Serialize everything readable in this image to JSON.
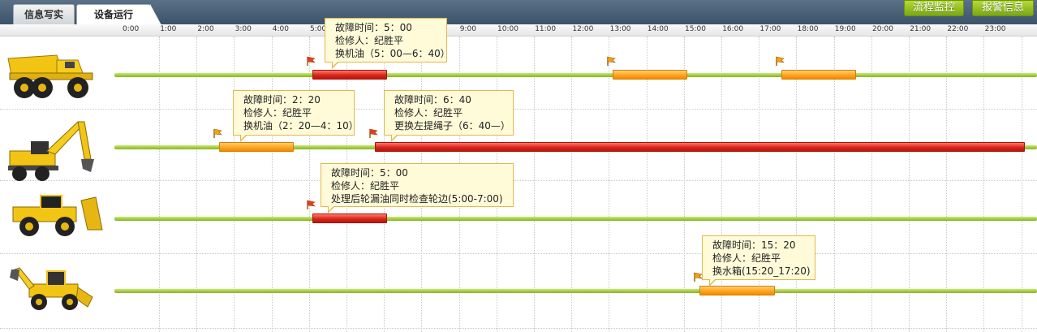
{
  "tabs": [
    {
      "label": "信息写实",
      "active": false
    },
    {
      "label": "设备运行",
      "active": true
    }
  ],
  "buttons": {
    "process": "流程监控",
    "alarm": "报警信息"
  },
  "hours": [
    "0:00",
    "1:00",
    "2:00",
    "3:00",
    "4:00",
    "5:00",
    "6:00",
    "7:00",
    "8:00",
    "9:00",
    "10:00",
    "11:00",
    "12:00",
    "13:00",
    "14:00",
    "15:00",
    "16:00",
    "17:00",
    "18:00",
    "19:00",
    "20:00",
    "21:00",
    "22:00",
    "23:00"
  ],
  "machines": [
    {
      "name": "dump-truck",
      "faults": [
        {
          "color": "red",
          "start": 5.0,
          "end": 7.0
        },
        {
          "color": "orange",
          "start": 13.0,
          "end": 15.0
        },
        {
          "color": "orange",
          "start": 17.5,
          "end": 19.5
        }
      ],
      "tooltip": {
        "time": "故障时间：5：00",
        "repairer": "检修人：纪胜平",
        "task": "换机油（5：00—6：40）"
      }
    },
    {
      "name": "wheel-excavator",
      "faults": [
        {
          "color": "orange",
          "start": 2.5,
          "end": 4.5
        },
        {
          "color": "red",
          "start": 6.67,
          "end": 24
        }
      ],
      "tooltips": [
        {
          "time": "故障时间：2：20",
          "repairer": "检修人：纪胜平",
          "task": "换机油（2：20—4：10）"
        },
        {
          "time": "故障时间：6：40",
          "repairer": "检修人：纪胜平",
          "task": "更换左提绳子（6：40—）"
        }
      ]
    },
    {
      "name": "wheel-dozer",
      "faults": [
        {
          "color": "red",
          "start": 5.0,
          "end": 7.0
        }
      ],
      "tooltip": {
        "time": "故障时间：5：00",
        "repairer": "检修人：纪胜平",
        "task": "处理后轮漏油同时检查轮边(5:00-7:00)"
      }
    },
    {
      "name": "backhoe-loader",
      "faults": [
        {
          "color": "orange",
          "start": 15.33,
          "end": 17.33
        }
      ],
      "tooltip": {
        "time": "故障时间：15：20",
        "repairer": "检修人：纪胜平",
        "task": "换水箱(15:20_17:20)"
      }
    }
  ],
  "colors": {
    "track": "#9ccc2e",
    "red": "#d9261a",
    "orange": "#ffa51f",
    "tooltip_bg": "#fffbd8",
    "tooltip_border": "#e3b650"
  }
}
